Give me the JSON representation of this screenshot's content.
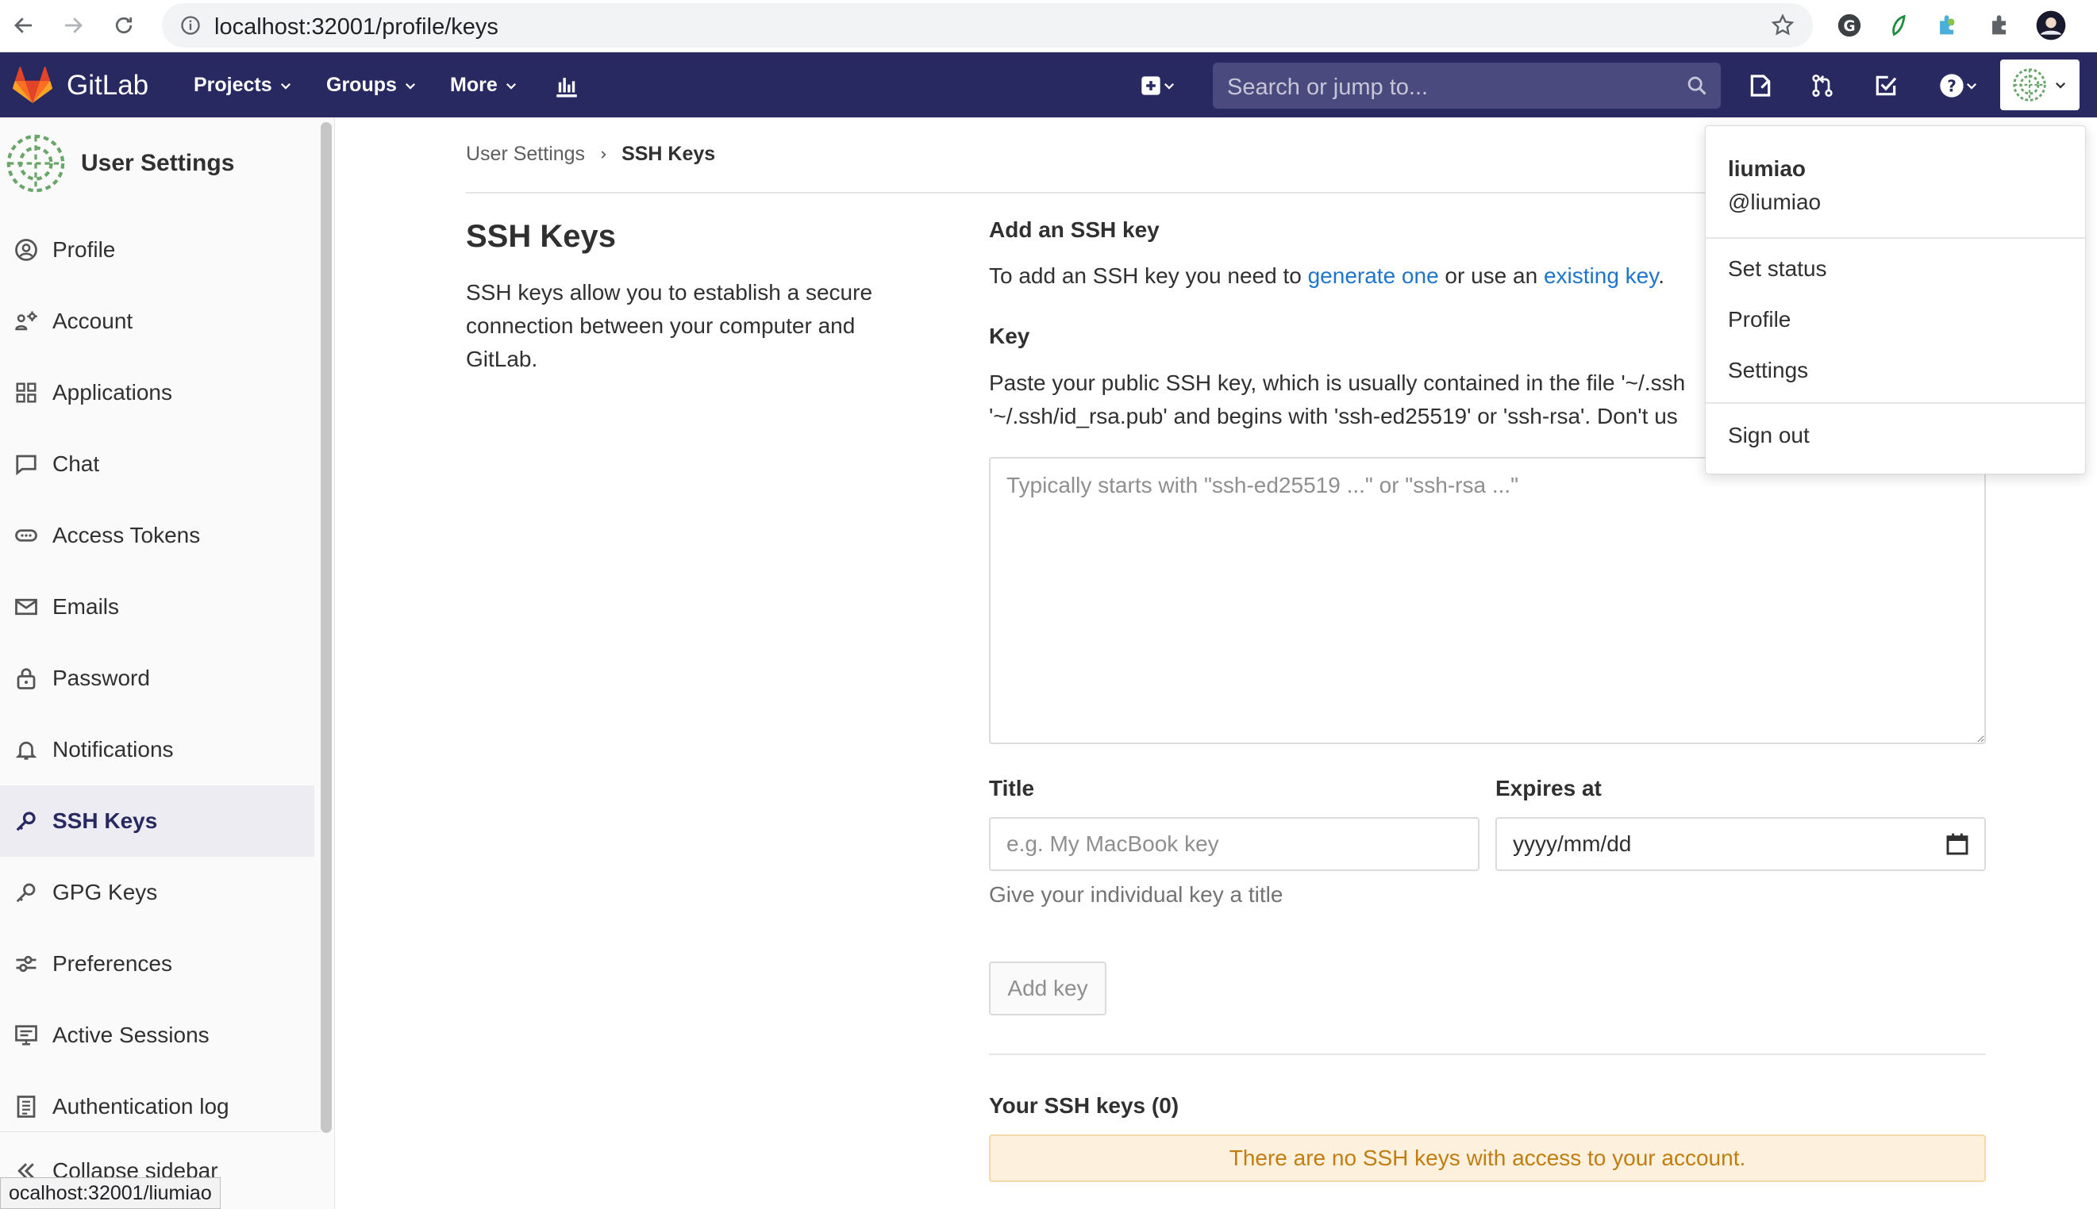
{
  "browser": {
    "url": "localhost:32001/profile/keys",
    "status_url": "ocalhost:32001/liumiao"
  },
  "header": {
    "brand": "GitLab",
    "menu": [
      "Projects",
      "Groups",
      "More"
    ],
    "search_placeholder": "Search or jump to...",
    "colors": {
      "bar": "#292961",
      "search": "#4a4a7f",
      "logo": "#e24329"
    }
  },
  "sidebar": {
    "title": "User Settings",
    "items": [
      {
        "label": "Profile",
        "icon": "profile-icon"
      },
      {
        "label": "Account",
        "icon": "account-icon"
      },
      {
        "label": "Applications",
        "icon": "applications-icon"
      },
      {
        "label": "Chat",
        "icon": "chat-icon"
      },
      {
        "label": "Access Tokens",
        "icon": "token-icon"
      },
      {
        "label": "Emails",
        "icon": "mail-icon"
      },
      {
        "label": "Password",
        "icon": "lock-icon"
      },
      {
        "label": "Notifications",
        "icon": "bell-icon"
      },
      {
        "label": "SSH Keys",
        "icon": "key-icon",
        "active": true
      },
      {
        "label": "GPG Keys",
        "icon": "key-icon"
      },
      {
        "label": "Preferences",
        "icon": "preferences-icon"
      },
      {
        "label": "Active Sessions",
        "icon": "monitor-icon"
      },
      {
        "label": "Authentication log",
        "icon": "log-icon"
      }
    ],
    "collapse_label": "Collapse sidebar"
  },
  "breadcrumb": {
    "parent": "User Settings",
    "current": "SSH Keys"
  },
  "intro": {
    "title": "SSH Keys",
    "description": "SSH keys allow you to establish a secure connection between your computer and GitLab."
  },
  "form": {
    "section_title": "Add an SSH key",
    "sub_prefix": "To add an SSH key you need to ",
    "link_generate": "generate one",
    "sub_middle": " or use an ",
    "link_existing": "existing key",
    "sub_suffix": ".",
    "key_label": "Key",
    "key_help_line1": "Paste your public SSH key, which is usually contained in the file '~/.ssh",
    "key_help_line2": "'~/.ssh/id_rsa.pub' and begins with 'ssh-ed25519' or 'ssh-rsa'. Don't us",
    "key_placeholder": "Typically starts with \"ssh-ed25519 ...\" or \"ssh-rsa ...\"",
    "title_label": "Title",
    "title_placeholder": "e.g. My MacBook key",
    "title_help": "Give your individual key a title",
    "expires_label": "Expires at",
    "expires_placeholder": "yyyy/mm/dd",
    "add_button": "Add key"
  },
  "keys_list": {
    "title": "Your SSH keys (0)",
    "empty_message": "There are no SSH keys with access to your account."
  },
  "user_menu": {
    "name": "liumiao",
    "username": "@liumiao",
    "set_status": "Set status",
    "profile": "Profile",
    "settings": "Settings",
    "sign_out": "Sign out"
  }
}
